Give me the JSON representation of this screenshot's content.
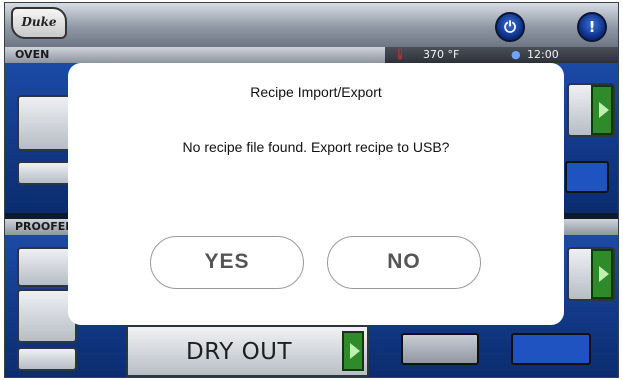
{
  "brand": {
    "logo_text": "Duke"
  },
  "topbar": {
    "power_icon": "power-icon",
    "alert_icon": "alert-icon"
  },
  "oven": {
    "header": "OVEN",
    "temperature": "370 °F",
    "time": "12:00",
    "thermometer_icon": "thermometer-icon",
    "clock_icon": "clock-icon"
  },
  "proofer": {
    "header": "PROOFER",
    "recipe_label": "DRY OUT"
  },
  "modal": {
    "title": "Recipe Import/Export",
    "message": "No recipe file found. Export recipe to USB?",
    "yes_label": "YES",
    "no_label": "NO"
  },
  "colors": {
    "accent_blue": "#0b2c6e",
    "status_green": "#2f8a2a",
    "modal_bg": "#ffffff"
  }
}
